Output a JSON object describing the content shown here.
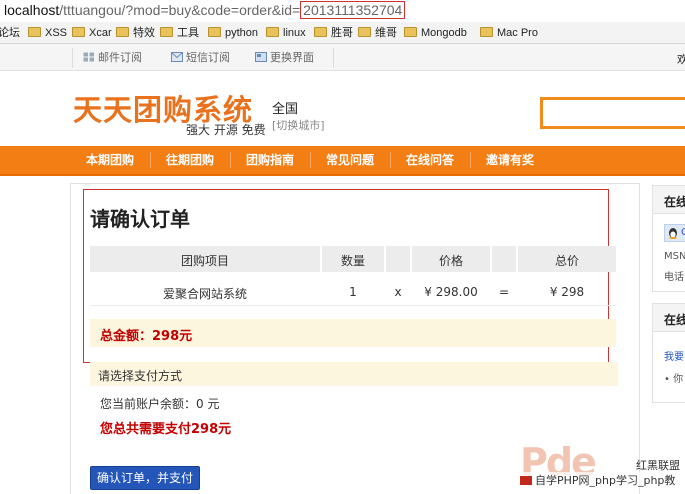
{
  "browser": {
    "url_host": "localhost",
    "url_rest": "/tttuangou/?mod=buy&code=order&id=",
    "url_id": "2013111352704",
    "bookmarks": [
      "论坛",
      "XSS",
      "Xcar",
      "特效",
      "工具",
      "python",
      "linux",
      "胜哥",
      "维哥",
      "Mongodb",
      "Mac Pro"
    ]
  },
  "util_bar": {
    "links": [
      "邮件订阅",
      "短信订阅",
      "更换界面"
    ],
    "right_text": "欢"
  },
  "header": {
    "logo": "天天团购系统",
    "slogan": "强大 开源 免费",
    "city": "全国",
    "city_switch": "[切换城市]"
  },
  "nav": {
    "items": [
      "本期团购",
      "往期团购",
      "团购指南",
      "常见问题",
      "在线问答",
      "邀请有奖"
    ]
  },
  "order": {
    "title": "请确认订单",
    "columns": [
      "团购项目",
      "数量",
      "价格",
      "总价"
    ],
    "row": {
      "item": "爱聚合网站系统",
      "quantity": "1",
      "times": "x",
      "price": "¥ 298.00",
      "equals": "=",
      "total": "¥ 298"
    },
    "grand_total": "总金额：298元"
  },
  "payment": {
    "title": "请选择支付方式",
    "balance": "您当前账户余额：0 元",
    "need_pay": "您总共需要支付298元",
    "confirm_button": "确认订单，并支付"
  },
  "sidebar": {
    "box1_title": "在线",
    "box1_qq": "C",
    "box1_msn": "MSN",
    "box1_phone": "电话",
    "box2_title": "在线",
    "box2_link": "我要",
    "box2_item": "• 你"
  },
  "watermark": {
    "mark": "Pde",
    "brand": "红黑联盟",
    "text": "自学PHP网_php学习_php教"
  },
  "colors": {
    "nav_orange": "#f27e14",
    "logo_orange": "#e8721e",
    "total_red": "#c40000",
    "button_blue": "#2356b8"
  }
}
